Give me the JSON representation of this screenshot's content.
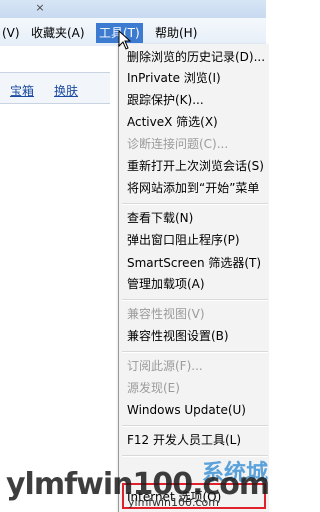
{
  "tab": {
    "close_glyph": "×"
  },
  "menubar": {
    "items": [
      {
        "label": "(V)"
      },
      {
        "label": "收藏夹(A)"
      },
      {
        "label": "工具(T)"
      },
      {
        "label": "帮助(H)"
      }
    ]
  },
  "page": {
    "links": [
      {
        "label": "宝箱"
      },
      {
        "label": "换肤"
      }
    ]
  },
  "tools_menu": {
    "items": [
      {
        "label": "删除浏览的历史记录(D)...",
        "disabled": false
      },
      {
        "label": "InPrivate 浏览(I)",
        "disabled": false
      },
      {
        "label": "跟踪保护(K)...",
        "disabled": false
      },
      {
        "label": "ActiveX 筛选(X)",
        "disabled": false
      },
      {
        "label": "诊断连接问题(C)...",
        "disabled": true
      },
      {
        "label": "重新打开上次浏览会话(S)",
        "disabled": false
      },
      {
        "label": "将网站添加到“开始”菜单",
        "disabled": false
      },
      {
        "label": "查看下载(N)",
        "disabled": false
      },
      {
        "label": "弹出窗口阻止程序(P)",
        "disabled": false
      },
      {
        "label": "SmartScreen 筛选器(T)",
        "disabled": false
      },
      {
        "label": "管理加载项(A)",
        "disabled": false
      },
      {
        "label": "兼容性视图(V)",
        "disabled": true
      },
      {
        "label": "兼容性视图设置(B)",
        "disabled": false
      },
      {
        "label": "订阅此源(F)...",
        "disabled": true
      },
      {
        "label": "源发现(E)",
        "disabled": true
      },
      {
        "label": "Windows Update(U)",
        "disabled": false
      },
      {
        "label": "F12 开发人员工具(L)",
        "disabled": false
      },
      {
        "label": "Internet 选项(O)",
        "disabled": false
      }
    ]
  },
  "watermark": {
    "domain": "ylmfwin100.com",
    "domain_small": "ylmfwin100.com",
    "cn_text": "系统城"
  },
  "colors": {
    "menu_highlight": "#3d7bd1",
    "annotation_box": "#e0202a"
  }
}
